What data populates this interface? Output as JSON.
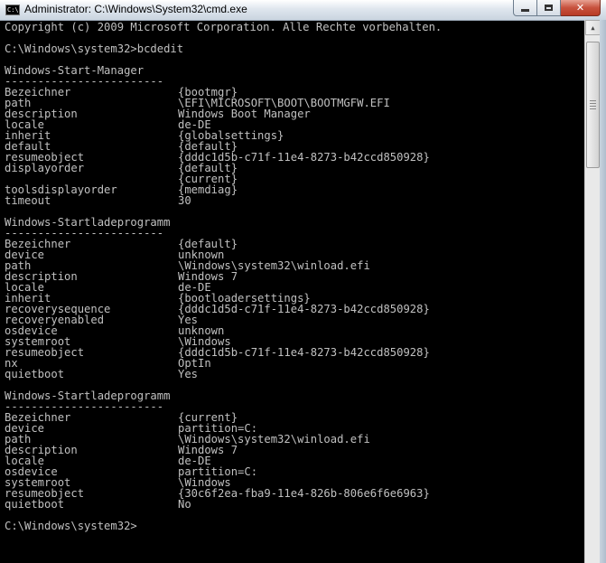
{
  "window": {
    "title": "Administrator: C:\\Windows\\System32\\cmd.exe",
    "icon": "cmd-icon",
    "icon_text": "C:\\",
    "controls": {
      "minimize": "minimize-icon",
      "maximize": "maximize-icon",
      "close": "close-icon",
      "close_glyph": "✕"
    }
  },
  "console": {
    "copyright": "Copyright (c) 2009 Microsoft Corporation. Alle Rechte vorbehalten.",
    "command_line": "C:\\Windows\\system32>bcdedit",
    "underline": "------------------------",
    "sections": [
      {
        "header": "Windows-Start-Manager",
        "entries": [
          {
            "key": "Bezeichner",
            "value": "{bootmgr}"
          },
          {
            "key": "path",
            "value": "\\EFI\\MICROSOFT\\BOOT\\BOOTMGFW.EFI"
          },
          {
            "key": "description",
            "value": "Windows Boot Manager"
          },
          {
            "key": "locale",
            "value": "de-DE"
          },
          {
            "key": "inherit",
            "value": "{globalsettings}"
          },
          {
            "key": "default",
            "value": "{default}"
          },
          {
            "key": "resumeobject",
            "value": "{dddc1d5b-c71f-11e4-8273-b42ccd850928}"
          },
          {
            "key": "displayorder",
            "value": "{default}"
          },
          {
            "key": "",
            "value": "{current}"
          },
          {
            "key": "toolsdisplayorder",
            "value": "{memdiag}"
          },
          {
            "key": "timeout",
            "value": "30"
          }
        ]
      },
      {
        "header": "Windows-Startladeprogramm",
        "entries": [
          {
            "key": "Bezeichner",
            "value": "{default}"
          },
          {
            "key": "device",
            "value": "unknown"
          },
          {
            "key": "path",
            "value": "\\Windows\\system32\\winload.efi"
          },
          {
            "key": "description",
            "value": "Windows 7"
          },
          {
            "key": "locale",
            "value": "de-DE"
          },
          {
            "key": "inherit",
            "value": "{bootloadersettings}"
          },
          {
            "key": "recoverysequence",
            "value": "{dddc1d5d-c71f-11e4-8273-b42ccd850928}"
          },
          {
            "key": "recoveryenabled",
            "value": "Yes"
          },
          {
            "key": "osdevice",
            "value": "unknown"
          },
          {
            "key": "systemroot",
            "value": "\\Windows"
          },
          {
            "key": "resumeobject",
            "value": "{dddc1d5b-c71f-11e4-8273-b42ccd850928}"
          },
          {
            "key": "nx",
            "value": "OptIn"
          },
          {
            "key": "quietboot",
            "value": "Yes"
          }
        ]
      },
      {
        "header": "Windows-Startladeprogramm",
        "entries": [
          {
            "key": "Bezeichner",
            "value": "{current}"
          },
          {
            "key": "device",
            "value": "partition=C:"
          },
          {
            "key": "path",
            "value": "\\Windows\\system32\\winload.efi"
          },
          {
            "key": "description",
            "value": "Windows 7"
          },
          {
            "key": "locale",
            "value": "de-DE"
          },
          {
            "key": "osdevice",
            "value": "partition=C:"
          },
          {
            "key": "systemroot",
            "value": "\\Windows"
          },
          {
            "key": "resumeobject",
            "value": "{30c6f2ea-fba9-11e4-826b-806e6f6e6963}"
          },
          {
            "key": "quietboot",
            "value": "No"
          }
        ]
      }
    ],
    "prompt": "C:\\Windows\\system32>"
  },
  "scrollbar": {
    "up_arrow": "▲",
    "up_icon": "scroll-up-arrow-icon"
  }
}
